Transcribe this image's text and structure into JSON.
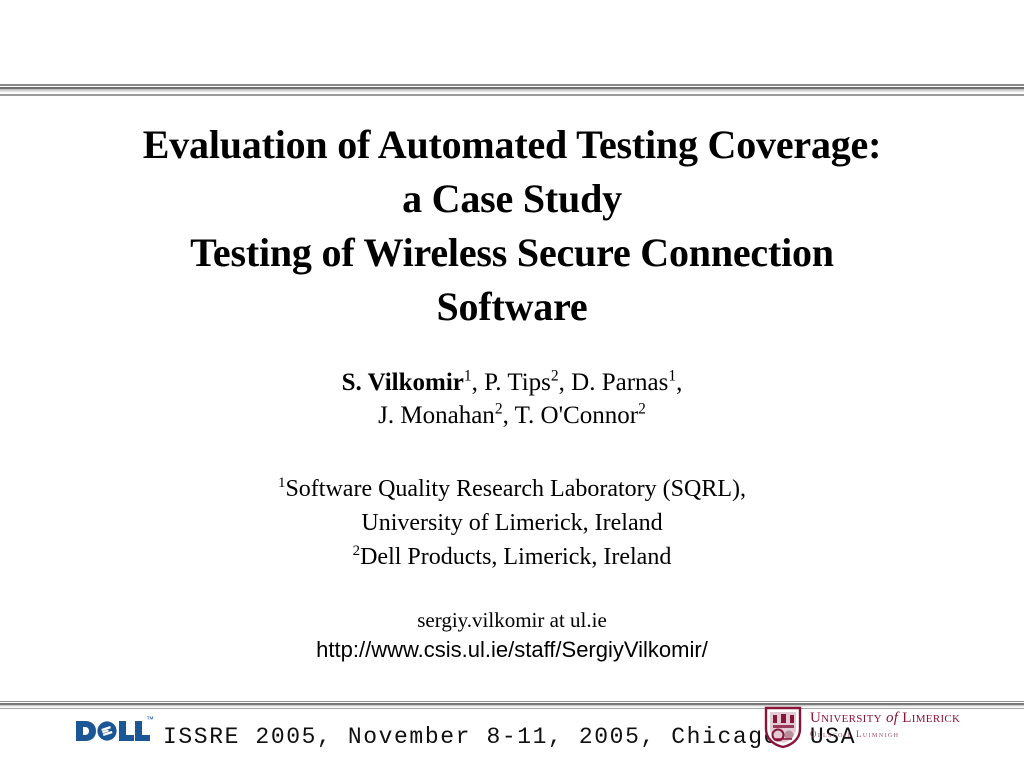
{
  "slide": {
    "title_lines": [
      "Evaluation of Automated Testing Coverage:",
      "a Case Study",
      "Testing of Wireless Secure Connection",
      "Software"
    ],
    "authors": {
      "line1_lead": "S. Vilkomir",
      "line1_lead_sup": "1",
      "line1_rest_a": ", P. Tips",
      "line1_sup_b": "2",
      "line1_rest_b": ", D. Parnas",
      "line1_sup_c": "1",
      "line1_rest_c": ",",
      "line2_a": "J. Monahan",
      "line2_sup_a": "2",
      "line2_b": ", T. O'Connor",
      "line2_sup_b": "2"
    },
    "affiliations": {
      "aff1_sup": "1",
      "aff1_text": "Software Quality Research Laboratory (SQRL),",
      "aff1_line2": "University of Limerick, Ireland",
      "aff2_sup": "2",
      "aff2_text": "Dell Products, Limerick, Ireland"
    },
    "contact": {
      "email": "sergiy.vilkomir at ul.ie",
      "url": "http://www.csis.ul.ie/staff/SergiyVilkomir/"
    }
  },
  "footer": {
    "conference": "ISSRE 2005, November 8-11, 2005, Chicago, USA",
    "dell_logo_text": "DELL",
    "dell_trademark": "™",
    "ul_name": "University of Limerick",
    "ul_name_of": "of",
    "ul_name_part1": "University",
    "ul_name_part2": "Limerick",
    "ul_irish": "Ollscoil Luimnigh"
  },
  "colors": {
    "dell_blue": "#1b5696",
    "ul_maroon": "#8a1538",
    "ul_maroon_light": "#9c4a63",
    "text": "#000000"
  }
}
